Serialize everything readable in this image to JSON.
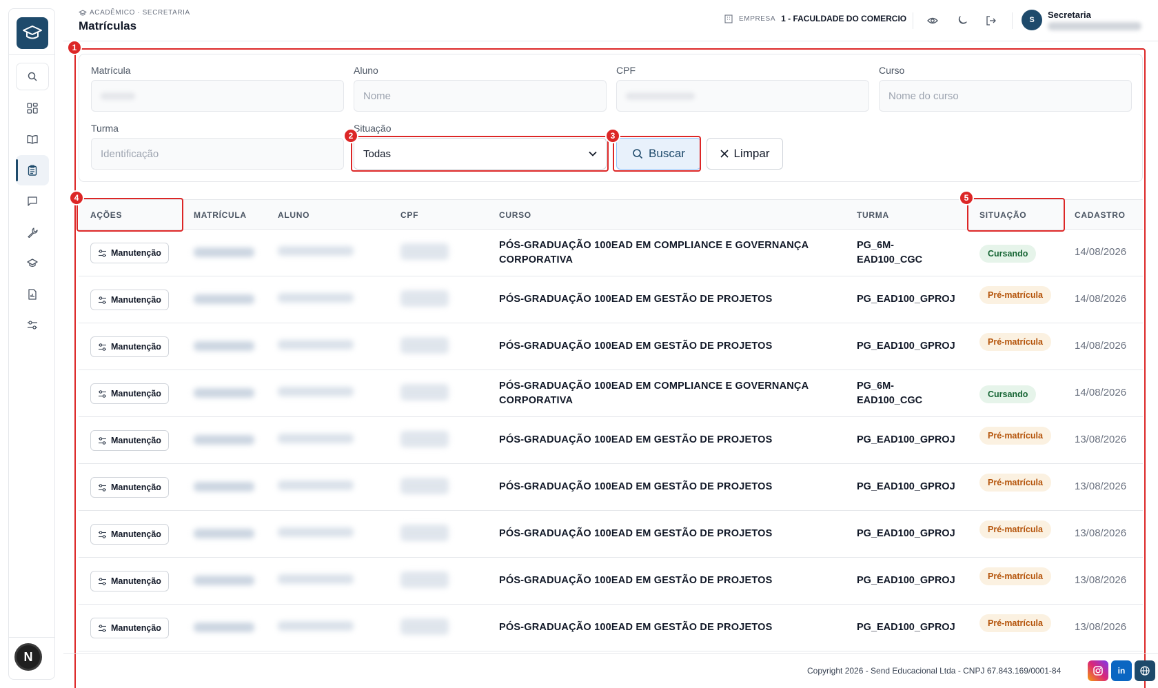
{
  "header": {
    "breadcrumb": "ACADÊMICO · SECRETARIA",
    "title": "Matrículas",
    "company_label": "EMPRESA",
    "company_value": "1 - FACULDADE DO COMERCIO",
    "user_initial": "S",
    "user_name": "Secretaria"
  },
  "sidebar": {
    "bottom_avatar": "N"
  },
  "annotations": [
    "1",
    "2",
    "3",
    "4",
    "5"
  ],
  "filters": {
    "matricula_label": "Matrícula",
    "aluno_label": "Aluno",
    "aluno_placeholder": "Nome",
    "cpf_label": "CPF",
    "curso_label": "Curso",
    "curso_placeholder": "Nome do curso",
    "turma_label": "Turma",
    "turma_placeholder": "Identificação",
    "situacao_label": "Situação",
    "situacao_value": "Todas",
    "search_button": "Buscar",
    "clear_button": "Limpar"
  },
  "table": {
    "columns": [
      "AÇÕES",
      "MATRÍCULA",
      "ALUNO",
      "CPF",
      "CURSO",
      "TURMA",
      "SITUAÇÃO",
      "CADASTRO"
    ],
    "action_label": "Manutenção",
    "rows": [
      {
        "curso": "PÓS-GRADUAÇÃO 100EAD EM COMPLIANCE E GOVERNANÇA CORPORATIVA",
        "turma": "PG_6M-EAD100_CGC",
        "situacao": "Cursando",
        "cadastro": "14/08/2026"
      },
      {
        "curso": "PÓS-GRADUAÇÃO 100EAD EM GESTÃO DE PROJETOS",
        "turma": "PG_EAD100_GPROJ",
        "situacao": "Pré-matrícula",
        "cadastro": "14/08/2026"
      },
      {
        "curso": "PÓS-GRADUAÇÃO 100EAD EM GESTÃO DE PROJETOS",
        "turma": "PG_EAD100_GPROJ",
        "situacao": "Pré-matrícula",
        "cadastro": "14/08/2026"
      },
      {
        "curso": "PÓS-GRADUAÇÃO 100EAD EM COMPLIANCE E GOVERNANÇA CORPORATIVA",
        "turma": "PG_6M-EAD100_CGC",
        "situacao": "Cursando",
        "cadastro": "14/08/2026"
      },
      {
        "curso": "PÓS-GRADUAÇÃO 100EAD EM GESTÃO DE PROJETOS",
        "turma": "PG_EAD100_GPROJ",
        "situacao": "Pré-matrícula",
        "cadastro": "13/08/2026"
      },
      {
        "curso": "PÓS-GRADUAÇÃO 100EAD EM GESTÃO DE PROJETOS",
        "turma": "PG_EAD100_GPROJ",
        "situacao": "Pré-matrícula",
        "cadastro": "13/08/2026"
      },
      {
        "curso": "PÓS-GRADUAÇÃO 100EAD EM GESTÃO DE PROJETOS",
        "turma": "PG_EAD100_GPROJ",
        "situacao": "Pré-matrícula",
        "cadastro": "13/08/2026"
      },
      {
        "curso": "PÓS-GRADUAÇÃO 100EAD EM GESTÃO DE PROJETOS",
        "turma": "PG_EAD100_GPROJ",
        "situacao": "Pré-matrícula",
        "cadastro": "13/08/2026"
      },
      {
        "curso": "PÓS-GRADUAÇÃO 100EAD EM GESTÃO DE PROJETOS",
        "turma": "PG_EAD100_GPROJ",
        "situacao": "Pré-matrícula",
        "cadastro": "13/08/2026"
      }
    ]
  },
  "footer": {
    "copyright": "Copyright 2026 - Send Educacional Ltda - CNPJ 67.843.169/0001-84",
    "social_linkedin": "in"
  },
  "colors": {
    "brand": "#1e4a6b",
    "annotation_red": "#dc2626",
    "cursando_bg": "#e6f4ea",
    "pre_bg": "#fbf1e1"
  }
}
